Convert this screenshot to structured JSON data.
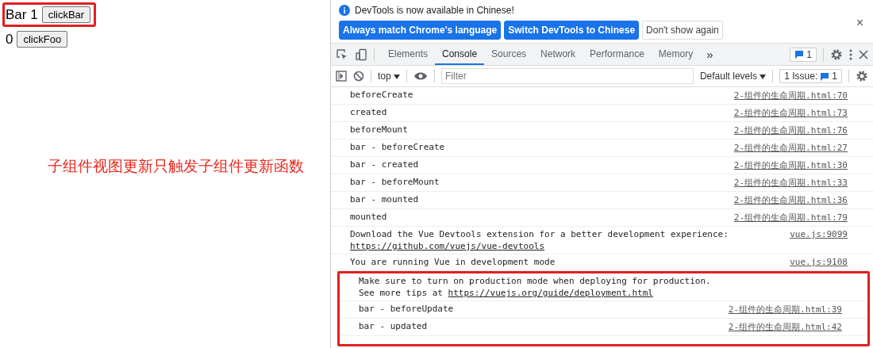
{
  "page": {
    "bar": {
      "label": "Bar 1",
      "button": "clickBar",
      "highlighted": true
    },
    "foo": {
      "label": "0",
      "button": "clickFoo",
      "highlighted": false
    },
    "annotation": "子组件视图更新只触发子组件更新函数"
  },
  "devtools": {
    "infobar": {
      "message": "DevTools is now available in Chinese!",
      "buttons": [
        {
          "label": "Always match Chrome's language",
          "kind": "primary"
        },
        {
          "label": "Switch DevTools to Chinese",
          "kind": "primary"
        },
        {
          "label": "Don't show again",
          "kind": "plain"
        }
      ],
      "close": "×"
    },
    "tabs": [
      {
        "label": "Elements",
        "selected": false
      },
      {
        "label": "Console",
        "selected": true
      },
      {
        "label": "Sources",
        "selected": false
      },
      {
        "label": "Network",
        "selected": false
      },
      {
        "label": "Performance",
        "selected": false
      },
      {
        "label": "Memory",
        "selected": false
      }
    ],
    "more": "»",
    "issues_badge": "1",
    "toolbar": {
      "context": "top",
      "filter_placeholder": "Filter",
      "levels": "Default levels",
      "issues_label": "1 Issue:",
      "issues_count": "1"
    },
    "entries": [
      {
        "lines": [
          "beforeCreate"
        ],
        "source": "2-组件的生命周期.html:70",
        "highlighted": false
      },
      {
        "lines": [
          "created"
        ],
        "source": "2-组件的生命周期.html:73",
        "highlighted": false
      },
      {
        "lines": [
          "beforeMount"
        ],
        "source": "2-组件的生命周期.html:76",
        "highlighted": false
      },
      {
        "lines": [
          "bar - beforeCreate"
        ],
        "source": "2-组件的生命周期.html:27",
        "highlighted": false
      },
      {
        "lines": [
          "bar - created"
        ],
        "source": "2-组件的生命周期.html:30",
        "highlighted": false
      },
      {
        "lines": [
          "bar - beforeMount"
        ],
        "source": "2-组件的生命周期.html:33",
        "highlighted": false
      },
      {
        "lines": [
          "bar - mounted"
        ],
        "source": "2-组件的生命周期.html:36",
        "highlighted": false
      },
      {
        "lines": [
          "mounted"
        ],
        "source": "2-组件的生命周期.html:79",
        "highlighted": false
      },
      {
        "lines": [
          "Download the Vue Devtools extension for a better development experience:"
        ],
        "link": "https://github.com/vuejs/vue-devtools",
        "source": "vue.js:9099",
        "highlighted": false
      },
      {
        "lines": [
          "You are running Vue in development mode"
        ],
        "source": "vue.js:9108",
        "highlighted": false
      },
      {
        "lines": [
          "Make sure to turn on production mode when deploying for production."
        ],
        "prefix": "See more tips at ",
        "link": "https://vuejs.org/guide/deployment.html",
        "highlighted": true
      },
      {
        "lines": [
          "bar - beforeUpdate"
        ],
        "source": "2-组件的生命周期.html:39",
        "highlighted": true
      },
      {
        "lines": [
          "bar - updated"
        ],
        "source": "2-组件的生命周期.html:42",
        "highlighted": true
      }
    ]
  }
}
